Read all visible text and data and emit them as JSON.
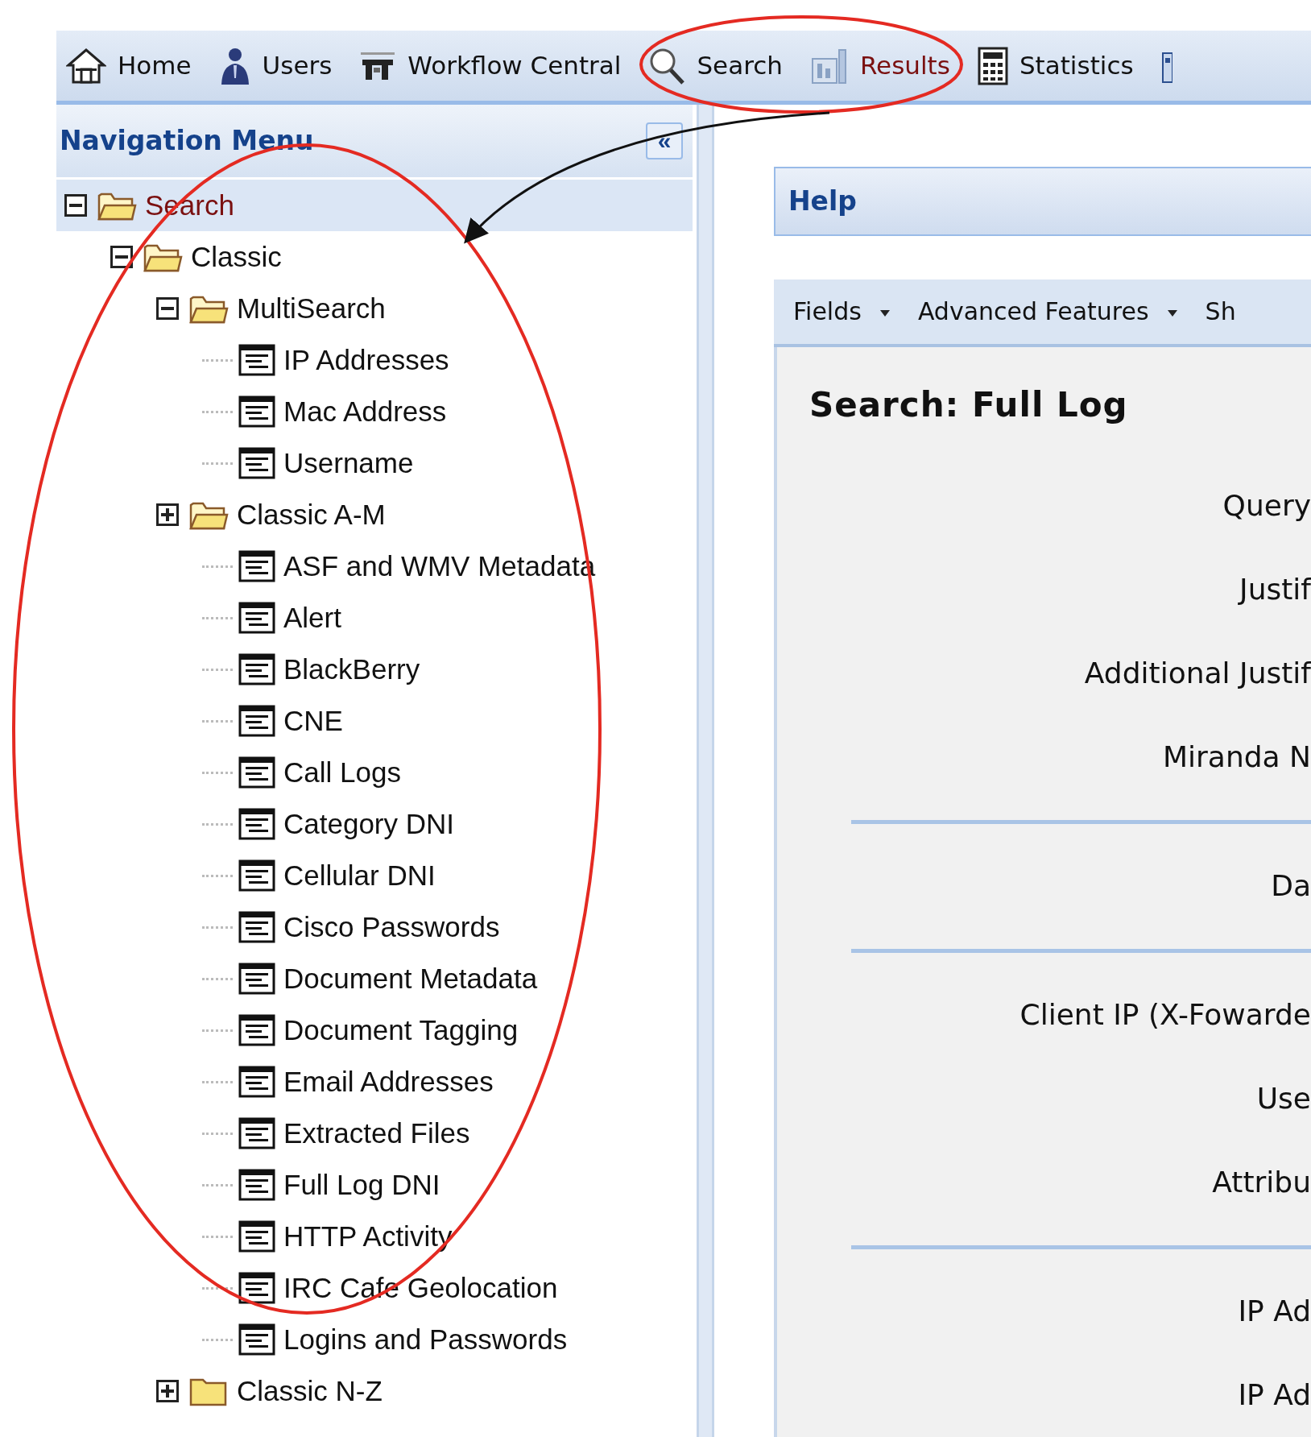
{
  "topbar": {
    "items": [
      {
        "label": "Home",
        "selected": false
      },
      {
        "label": "Users",
        "selected": false
      },
      {
        "label": "Workflow Central",
        "selected": false
      },
      {
        "label": "Search",
        "selected": false
      },
      {
        "label": "Results",
        "selected": true
      },
      {
        "label": "Statistics",
        "selected": false
      }
    ]
  },
  "navigation": {
    "title": "Navigation Menu",
    "collapse_button": "«",
    "tree": [
      {
        "label": "Search",
        "kind": "folder",
        "expanded": true,
        "selected": true,
        "children": [
          {
            "label": "Classic",
            "kind": "folder",
            "expanded": true,
            "selected": false,
            "children": [
              {
                "label": "MultiSearch",
                "kind": "folder",
                "expanded": true,
                "selected": false,
                "children": [
                  {
                    "label": "IP Addresses",
                    "kind": "document",
                    "selected": false
                  },
                  {
                    "label": "Mac Address",
                    "kind": "document",
                    "selected": false
                  },
                  {
                    "label": "Username",
                    "kind": "document",
                    "selected": false
                  }
                ]
              },
              {
                "label": "Classic A-M",
                "kind": "folder",
                "expanded": false,
                "selected": false,
                "children": [
                  {
                    "label": "ASF and WMV Metadata",
                    "kind": "document",
                    "selected": false
                  },
                  {
                    "label": "Alert",
                    "kind": "document",
                    "selected": false
                  },
                  {
                    "label": "BlackBerry",
                    "kind": "document",
                    "selected": false
                  },
                  {
                    "label": "CNE",
                    "kind": "document",
                    "selected": false
                  },
                  {
                    "label": "Call Logs",
                    "kind": "document",
                    "selected": false
                  },
                  {
                    "label": "Category DNI",
                    "kind": "document",
                    "selected": false
                  },
                  {
                    "label": "Cellular DNI",
                    "kind": "document",
                    "selected": false
                  },
                  {
                    "label": "Cisco Passwords",
                    "kind": "document",
                    "selected": false
                  },
                  {
                    "label": "Document Metadata",
                    "kind": "document",
                    "selected": false
                  },
                  {
                    "label": "Document Tagging",
                    "kind": "document",
                    "selected": false
                  },
                  {
                    "label": "Email Addresses",
                    "kind": "document",
                    "selected": false
                  },
                  {
                    "label": "Extracted Files",
                    "kind": "document",
                    "selected": false
                  },
                  {
                    "label": "Full Log DNI",
                    "kind": "document",
                    "selected": false
                  },
                  {
                    "label": "HTTP Activity",
                    "kind": "document",
                    "selected": false
                  },
                  {
                    "label": "IRC Cafe Geolocation",
                    "kind": "document",
                    "selected": false
                  },
                  {
                    "label": "Logins and Passwords",
                    "kind": "document",
                    "selected": false
                  }
                ]
              },
              {
                "label": "Classic N-Z",
                "kind": "folder",
                "expanded": false,
                "selected": false
              }
            ]
          }
        ]
      }
    ]
  },
  "help": {
    "title": "Help"
  },
  "toolbar": [
    {
      "label": "Fields",
      "dropdown": true
    },
    {
      "label": "Advanced Features",
      "dropdown": true
    },
    {
      "label": "Sh",
      "dropdown": false
    }
  ],
  "form": {
    "title": "Search: Full Log",
    "rows": [
      {
        "kind": "field",
        "label": "Query"
      },
      {
        "kind": "field",
        "label": "Justif"
      },
      {
        "kind": "field",
        "label": "Additional Justif"
      },
      {
        "kind": "field",
        "label": "Miranda N"
      },
      {
        "kind": "separator"
      },
      {
        "kind": "field",
        "label": "Da"
      },
      {
        "kind": "separator"
      },
      {
        "kind": "field",
        "label": "Client IP (X-Fowarde"
      },
      {
        "kind": "field",
        "label": "Use"
      },
      {
        "kind": "field",
        "label": "Attribu"
      },
      {
        "kind": "separator"
      },
      {
        "kind": "field",
        "label": "IP Ad"
      },
      {
        "kind": "field",
        "label": "IP Ad"
      }
    ]
  }
}
